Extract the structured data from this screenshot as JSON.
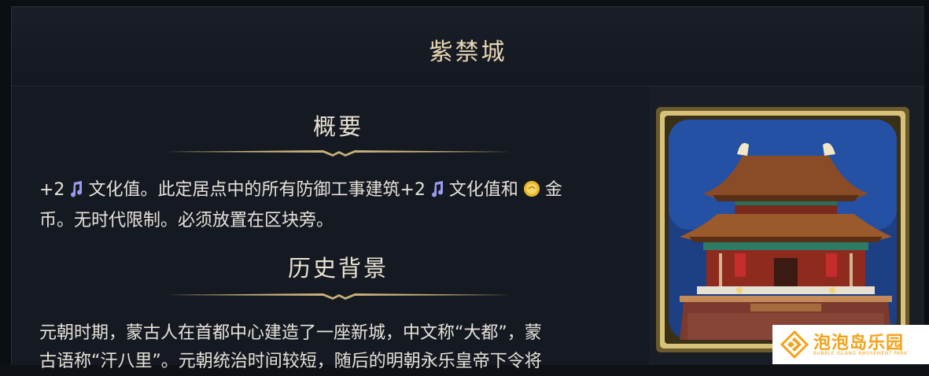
{
  "window": {
    "title": "紫禁城"
  },
  "summary": {
    "heading": "概要",
    "line1_prefix": "+2",
    "line1_text_a": "文化值。此定居点中的所有防御工事建筑+2",
    "line1_text_b": "文化值和",
    "line1_text_c": "金",
    "line2": "币。无时代限制。必须放置在区块旁。"
  },
  "history": {
    "heading": "历史背景",
    "line1": "元朝时期，蒙古人在首都中心建造了一座新城，中文称“大都”，蒙",
    "line2": "古语称“汗八里”。元朝统治时间较短，随后的明朝永乐皇帝下令将"
  },
  "icons": {
    "culture": "music-note-icon",
    "gold": "gold-coin-icon"
  },
  "watermark": {
    "title": "泡泡岛乐园",
    "subtitle": "BUBBLE ISLAND AMUSEMENT PARK"
  },
  "colors": {
    "accent_gold": "#c9b27a",
    "culture_icon": "#9b9cf0",
    "title_text": "#e8d7b4",
    "watermark_orange": "#f4a21a"
  }
}
